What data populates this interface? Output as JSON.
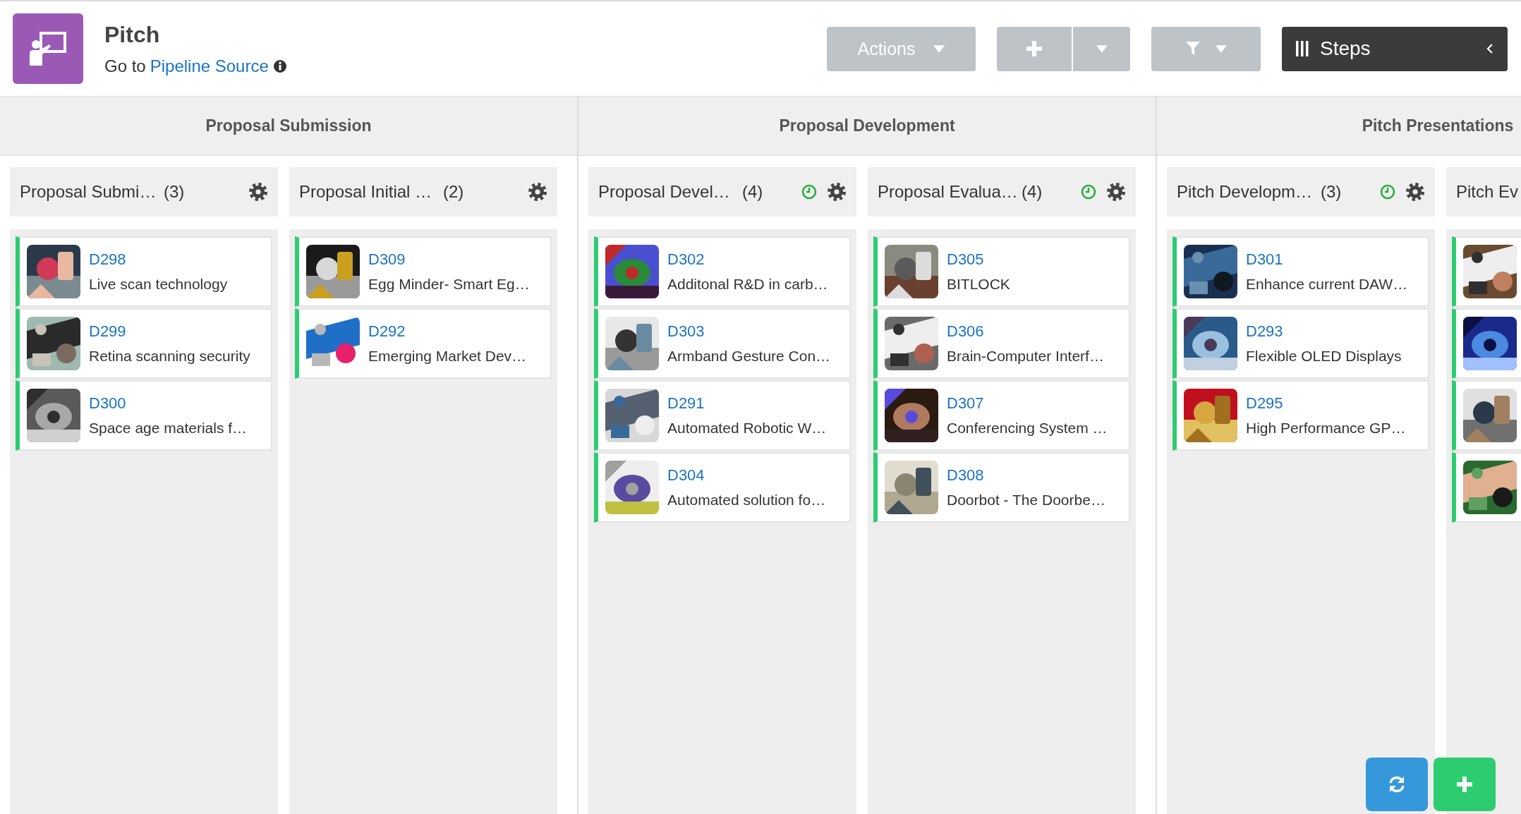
{
  "header": {
    "title": "Pitch",
    "goto_prefix": "Go to",
    "goto_link": "Pipeline Source"
  },
  "toolbar": {
    "actions_label": "Actions",
    "steps_label": "Steps"
  },
  "stages": [
    {
      "title": "Proposal Submission",
      "lanes": [
        {
          "title": "Proposal Submi…",
          "count": "(3)",
          "timer": false,
          "cards": [
            {
              "kind": "item",
              "id": "D298",
              "title": "Live scan technology"
            },
            {
              "kind": "item",
              "id": "D299",
              "title": "Retina scanning security"
            },
            {
              "kind": "item",
              "id": "D300",
              "title": "Space age materials f…"
            }
          ]
        },
        {
          "title": "Proposal Initial …",
          "count": "(2)",
          "timer": false,
          "cards": [
            {
              "kind": "item",
              "id": "D309",
              "title": "Egg Minder- Smart Eg…"
            },
            {
              "kind": "item",
              "id": "D292",
              "title": "Emerging Market Dev…"
            }
          ]
        }
      ]
    },
    {
      "title": "Proposal Development",
      "lanes": [
        {
          "title": "Proposal Devel…",
          "count": "(4)",
          "timer": true,
          "cards": [
            {
              "kind": "item",
              "id": "D302",
              "title": "Additonal R&D in carb…"
            },
            {
              "kind": "item",
              "id": "D303",
              "title": "Armband Gesture Con…"
            },
            {
              "kind": "item",
              "id": "D291",
              "title": "Automated Robotic W…"
            },
            {
              "kind": "item",
              "id": "D304",
              "title": "Automated solution fo…"
            }
          ]
        },
        {
          "title": "Proposal Evalua…",
          "count": "(4)",
          "timer": true,
          "cards": [
            {
              "kind": "item",
              "id": "D305",
              "title": "BITLOCK"
            },
            {
              "kind": "item",
              "id": "D306",
              "title": "Brain-Computer Interf…"
            },
            {
              "kind": "item",
              "id": "D307",
              "title": "Conferencing System …"
            },
            {
              "kind": "item",
              "id": "D308",
              "title": "Doorbot - The Doorbe…"
            }
          ]
        }
      ]
    },
    {
      "title": "Pitch Presentations",
      "lanes": [
        {
          "title": "Pitch Developm…",
          "count": "(3)",
          "timer": true,
          "cards": [
            {
              "kind": "item",
              "id": "D301",
              "title": "Enhance current DAW…"
            },
            {
              "kind": "item",
              "id": "D293",
              "title": "Flexible OLED Displays"
            },
            {
              "kind": "item",
              "id": "D295",
              "title": "High Performance GP…"
            }
          ]
        },
        {
          "title": "Pitch Ev"
        }
      ]
    }
  ]
}
